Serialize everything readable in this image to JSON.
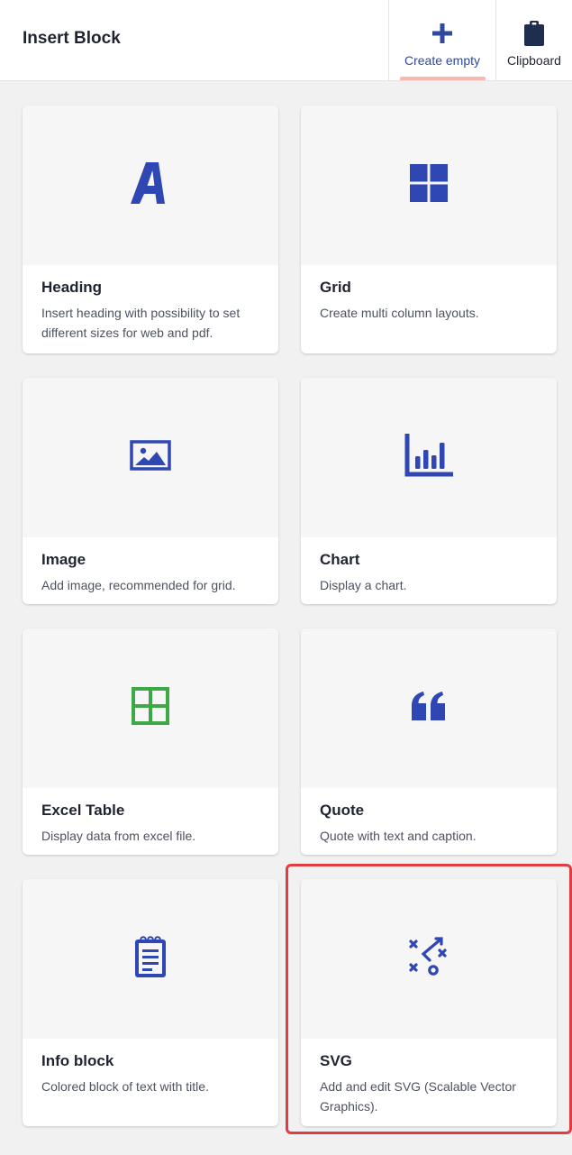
{
  "header": {
    "title": "Insert Block",
    "create_empty_label": "Create empty",
    "clipboard_label": "Clipboard"
  },
  "colors": {
    "accent": "#2f47b3",
    "excel_green": "#3da845",
    "active_tab": "#f5b9b2",
    "highlight": "#e23c41"
  },
  "blocks": [
    {
      "title": "Heading",
      "description": "Insert heading with possibility to set different sizes for web and pdf.",
      "icon": "heading-letter-a-icon"
    },
    {
      "title": "Grid",
      "description": "Create multi column layouts.",
      "icon": "grid-icon"
    },
    {
      "title": "Image",
      "description": "Add image, recommended for grid.",
      "icon": "image-icon"
    },
    {
      "title": "Chart",
      "description": "Display a chart.",
      "icon": "bar-chart-icon"
    },
    {
      "title": "Excel Table",
      "description": "Display data from excel file.",
      "icon": "table-icon"
    },
    {
      "title": "Quote",
      "description": "Quote with text and caption.",
      "icon": "quote-icon"
    },
    {
      "title": "Info block",
      "description": "Colored block of text with title.",
      "icon": "notepad-icon"
    },
    {
      "title": "SVG",
      "description": "Add and edit SVG (Scalable Vector Graphics).",
      "icon": "svg-strategy-icon"
    }
  ]
}
